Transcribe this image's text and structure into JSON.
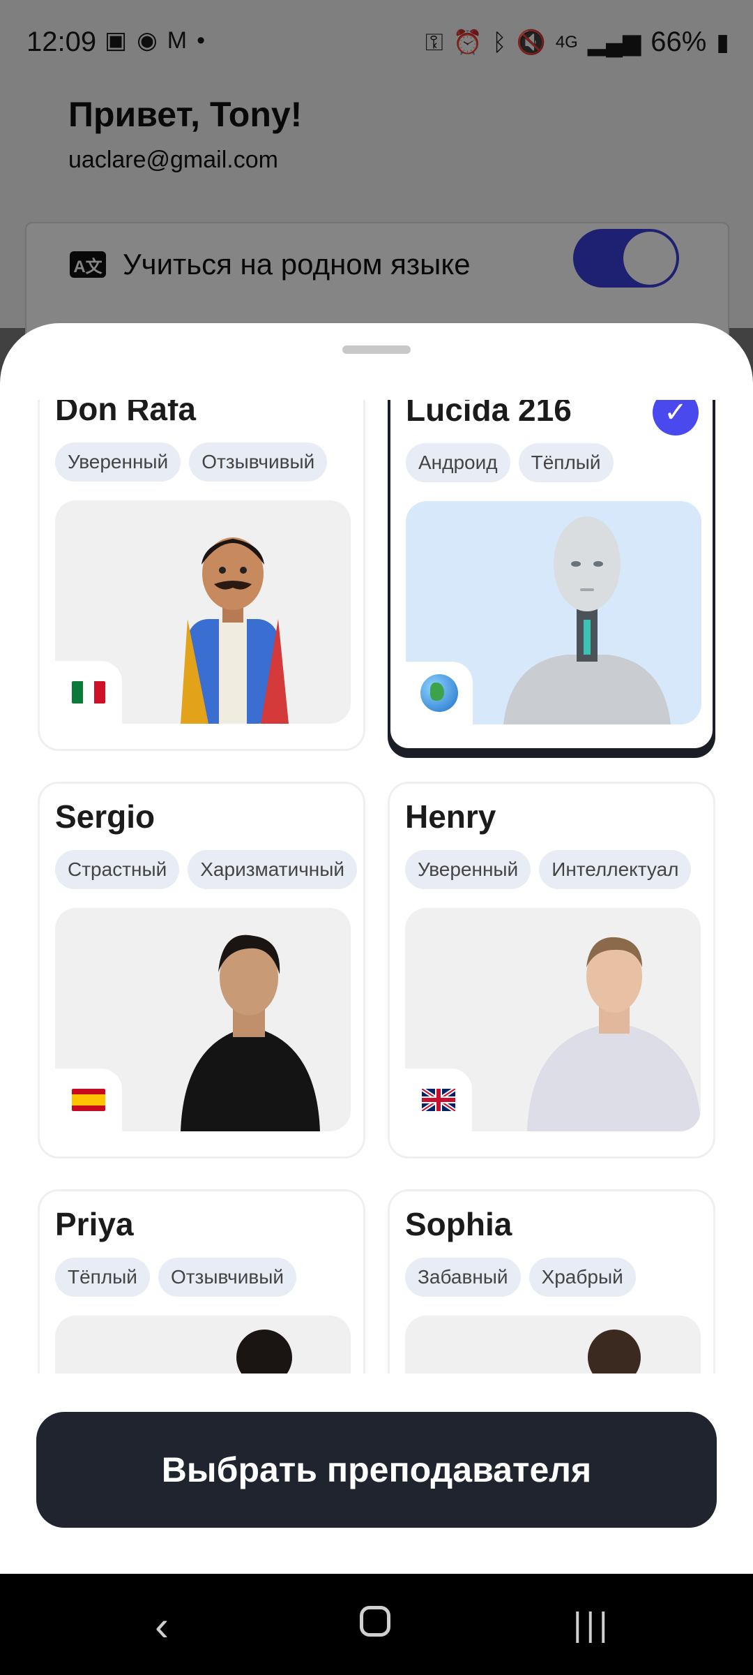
{
  "status_bar": {
    "time": "12:09",
    "battery": "66%",
    "network": "4G"
  },
  "header": {
    "greeting": "Привет, Tony!",
    "email": "uaclare@gmail.com"
  },
  "settings": {
    "native_language_label": "Учиться на родном языке",
    "native_language_enabled": true,
    "icon": "translate-icon"
  },
  "tutors": [
    {
      "name": "Don Rafa",
      "tags": [
        "Уверенный",
        "Отзывчивый"
      ],
      "flag": "mexico-flag",
      "selected": false
    },
    {
      "name": "Lucida 216",
      "tags": [
        "Андроид",
        "Тёплый"
      ],
      "flag": "globe-icon",
      "selected": true
    },
    {
      "name": "Sergio",
      "tags": [
        "Страстный",
        "Харизматичный"
      ],
      "flag": "spain-flag",
      "selected": false
    },
    {
      "name": "Henry",
      "tags": [
        "Уверенный",
        "Интеллектуал"
      ],
      "flag": "uk-flag",
      "selected": false
    },
    {
      "name": "Priya",
      "tags": [
        "Тёплый",
        "Отзывчивый"
      ],
      "flag": "",
      "selected": false
    },
    {
      "name": "Sophia",
      "tags": [
        "Забавный",
        "Храбрый"
      ],
      "flag": "",
      "selected": false
    }
  ],
  "cta": {
    "label": "Выбрать преподавателя"
  },
  "colors": {
    "accent": "#4a49ee",
    "toggle": "#3b3fd9",
    "button": "#20242f",
    "tag_bg": "#e8ecf4"
  }
}
